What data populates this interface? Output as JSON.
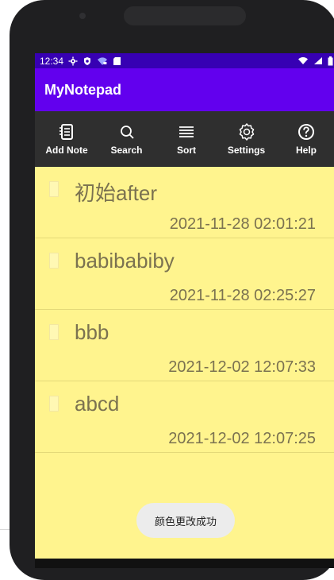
{
  "status": {
    "time": "12:34",
    "left_icons": [
      "gear-icon",
      "shield-icon",
      "wifi-lock-icon",
      "sd-card-icon"
    ],
    "right_icons": [
      "wifi-icon",
      "signal-icon",
      "battery-icon"
    ]
  },
  "app": {
    "title": "MyNotepad"
  },
  "toolbar": {
    "items": [
      {
        "label": "Add Note",
        "icon": "notebook-icon"
      },
      {
        "label": "Search",
        "icon": "search-icon"
      },
      {
        "label": "Sort",
        "icon": "sort-icon"
      },
      {
        "label": "Settings",
        "icon": "settings-icon"
      },
      {
        "label": "Help",
        "icon": "help-icon"
      }
    ]
  },
  "notes": [
    {
      "title": "初始after",
      "time": "2021-11-28 02:01:21"
    },
    {
      "title": "babibabiby",
      "time": "2021-11-28 02:25:27"
    },
    {
      "title": "bbb",
      "time": "2021-12-02 12:07:33"
    },
    {
      "title": "abcd",
      "time": "2021-12-02 12:07:25"
    }
  ],
  "toast": {
    "text": "颜色更改成功"
  },
  "colors": {
    "status_bar": "#3700b3",
    "app_bar": "#6200ee",
    "toolbar": "#2f2f2f",
    "screen_background": "#fff48e",
    "note_text": "#7b7250"
  }
}
